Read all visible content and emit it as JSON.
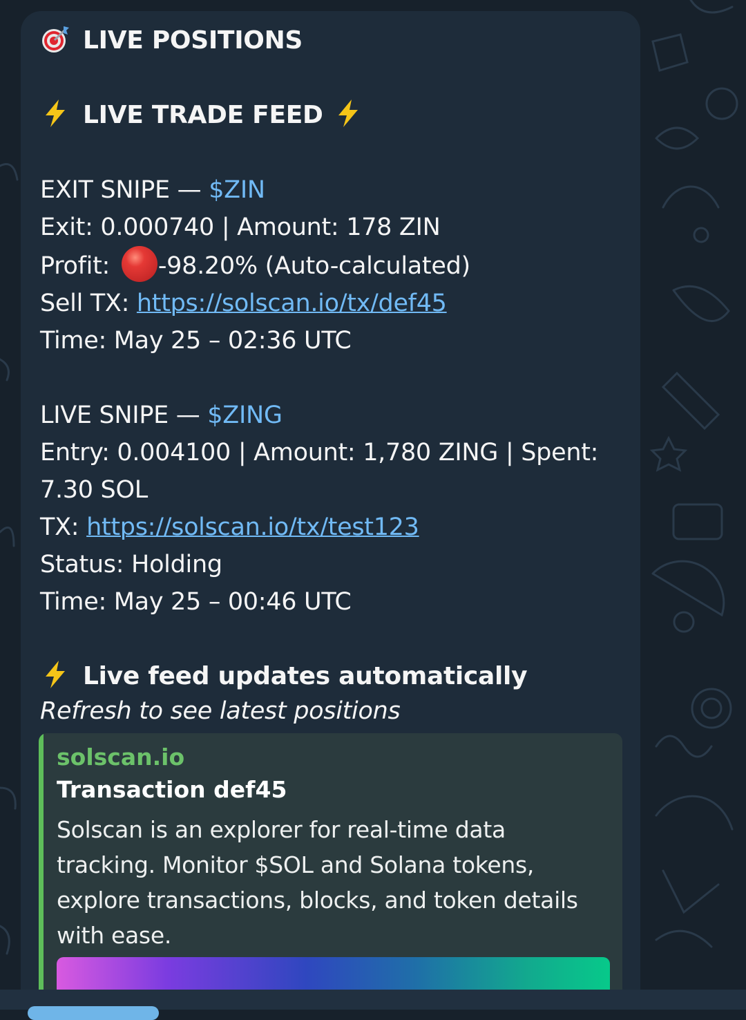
{
  "message": {
    "header": {
      "icon": "direct-hit-emoji",
      "text": "LIVE POSITIONS"
    },
    "feed_title": {
      "icon": "high-voltage-emoji",
      "text": "LIVE TRADE FEED"
    },
    "exit_snipe": {
      "label": "EXIT SNIPE — ",
      "token": "$ZIN",
      "exit_line": "Exit: 0.000740 | Amount: 178 ZIN",
      "profit_label": "Profit: ",
      "profit_icon": "red-circle-emoji",
      "profit_value": "-98.20% (Auto-calculated)",
      "tx_label": "Sell TX: ",
      "tx_link": "https://solscan.io/tx/def45",
      "time": "Time: May 25 – 02:36 UTC"
    },
    "live_snipe": {
      "label": "LIVE SNIPE — ",
      "token": "$ZING",
      "entry_line_1": "Entry: 0.004100 | Amount: 1,780 ZING | Spent:",
      "entry_line_2": "7.30 SOL",
      "tx_label": "TX: ",
      "tx_link": "https://solscan.io/tx/test123",
      "status": "Status: Holding",
      "time": "Time: May 25 – 00:46 UTC"
    },
    "footer": {
      "icon": "high-voltage-emoji",
      "updates": "Live feed updates automatically",
      "refresh": "Refresh to see latest positions"
    },
    "link_preview": {
      "site": "solscan.io",
      "title": "Transaction def45",
      "description_lines": [
        "Solscan is an explorer for real-time data",
        "tracking. Monitor $SOL and Solana tokens,",
        "explore transactions, blocks, and token details",
        "with ease."
      ]
    }
  },
  "colors": {
    "background": "#17212b",
    "bubble": "#1e2c3a",
    "link": "#71baf5",
    "preview_accent": "#5ebd5a",
    "preview_background": "#2b3b3e"
  }
}
